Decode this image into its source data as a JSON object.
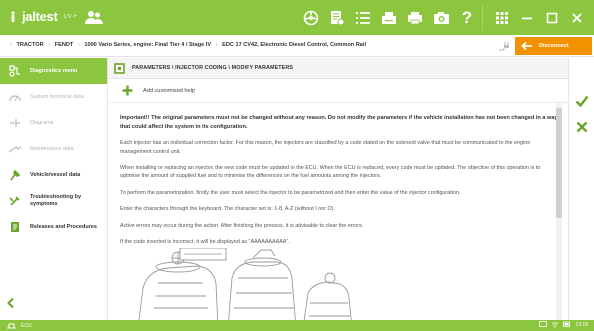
{
  "app": {
    "logo_text": "jaltest",
    "logo_sub": "CV·F",
    "brand_green": "#8cc63f",
    "accent_orange": "#f39200"
  },
  "toolbar_icons": [
    "vehicle-icon",
    "report-icon",
    "list-icon",
    "print-icon",
    "printer-icon",
    "camera-icon",
    "help-icon",
    "grid-icon",
    "minimize-icon",
    "maximize-icon",
    "close-icon"
  ],
  "toolbar": {
    "help_glyph": "?"
  },
  "breadcrumb": {
    "items": [
      "TRACTOR",
      "FENDT",
      "1000 Vario Series, engine: Final Tier 4 / Stage IV",
      "EDC 17 CV42, Electronic Diesel Control, Common Rail"
    ],
    "separator": "›",
    "disconnect_label": "Disconnect"
  },
  "sidebar": {
    "items": [
      {
        "label": "Diagnostics menu",
        "state": "active",
        "icon": "diagnostics-icon"
      },
      {
        "label": "System technical data",
        "state": "disabled",
        "icon": "technical-data-icon"
      },
      {
        "label": "Diagrams",
        "state": "disabled",
        "icon": "diagrams-icon"
      },
      {
        "label": "Maintenance data",
        "state": "disabled",
        "icon": "maintenance-icon"
      },
      {
        "label": "Vehicle/vessel data",
        "state": "enabled",
        "icon": "vehicle-data-icon"
      },
      {
        "label": "Troubleshooting by symptoms",
        "state": "enabled",
        "icon": "troubleshooting-icon"
      },
      {
        "label": "Releases and Procedures",
        "state": "enabled",
        "icon": "releases-icon"
      }
    ],
    "back_label": "back"
  },
  "main": {
    "title": "PARAMETERS \\ INJECTOR CODING \\ MODIFY PARAMETERS",
    "add_help_label": "Add customised help",
    "paragraphs": [
      {
        "text": "Important!! The original parameters must not be changed without any reason. Do not modify the parameters if the vehicle installation has not been changed in a way that could affect the system in its configuration.",
        "strong": true
      },
      {
        "text": "Each injector has an individual correction factor. For this reason, the injectors are classified by a code stated on the solenoid valve that must be communicated to the engine management control unit.",
        "strong": false
      },
      {
        "text": "When installing or replacing an injector, the new code must be updated in the ECU. When the ECU is replaced, every code must be updated. The objective of this operation is to optimise the amount of supplied fuel and to minimise the differences on the fuel amounts among the injectors.",
        "strong": false
      },
      {
        "text": "To perform the parametrization, firstly the user must select the injector to be parametrized and then enter the value of the injector configuration.",
        "strong": false
      },
      {
        "text": "Enter the characters through the keyboard. The character set is: 1-8, A-Z (without I nor O).",
        "strong": false
      },
      {
        "text": "Active errors may occur during the action. After finishing the process, it is advisable to clear the errors.",
        "strong": false
      },
      {
        "text": "If the code inserted is incorrect, it will be displayed as \"AAAAAAAAAA\".",
        "strong": false
      }
    ]
  },
  "actions": {
    "accept_icon": "check-icon",
    "cancel_icon": "cross-icon"
  },
  "statusbar": {
    "left_text": "ECU",
    "time": "13:18"
  }
}
